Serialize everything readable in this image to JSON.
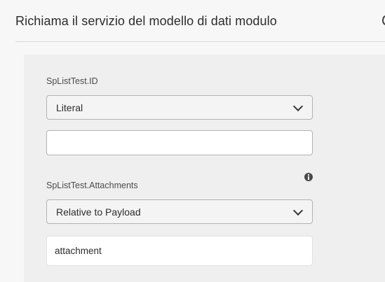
{
  "header": {
    "title": "Richiama il servizio del modello di dati modulo"
  },
  "fields": [
    {
      "label": "SpListTest.ID",
      "mode": "Literal",
      "value": ""
    },
    {
      "label": "SpListTest.Attachments",
      "mode": "Relative to Payload",
      "value": "attachment",
      "info_icon": "info-icon"
    }
  ],
  "icons": {
    "select_arrow": "chevron-down-icon",
    "info": "info-icon"
  },
  "colors": {
    "page_background": "#f7f7f7",
    "panel_background": "#efefef",
    "field_border": "#b3b3b3",
    "text": "#2c2c2c"
  }
}
